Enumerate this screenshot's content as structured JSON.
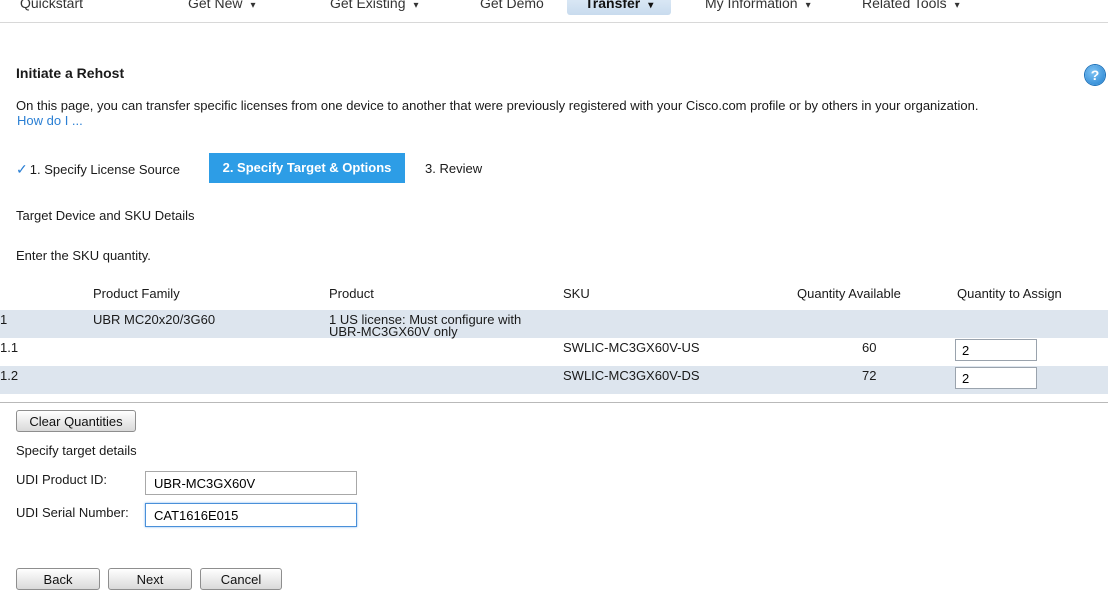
{
  "nav": {
    "items": [
      {
        "label": "Quickstart",
        "caret": ""
      },
      {
        "label": "Get New",
        "caret": "▾"
      },
      {
        "label": "Get Existing",
        "caret": "▾"
      },
      {
        "label": "Get Demo",
        "caret": ""
      },
      {
        "label": "Transfer",
        "caret": "▾"
      },
      {
        "label": "My Information",
        "caret": "▾"
      },
      {
        "label": "Related Tools",
        "caret": "▾"
      }
    ],
    "active_index": 4
  },
  "page": {
    "title": "Initiate a Rehost",
    "help_icon": "?",
    "intro": "On this page, you can transfer specific licenses from one device to another that were previously registered with your Cisco.com profile or by others in your organization.",
    "how_do_i": "How do I ..."
  },
  "steps": {
    "check": "✓",
    "step1": "1. Specify License Source",
    "step2": "2. Specify Target & Options",
    "step3": "3. Review",
    "active_color": "#2d9de6"
  },
  "details": {
    "heading": "Target Device and SKU Details",
    "instruction": "Enter the SKU quantity."
  },
  "table": {
    "headers": {
      "product_family": "Product Family",
      "product": "Product",
      "sku": "SKU",
      "qty_available": "Quantity Available",
      "qty_assign": "Quantity to Assign"
    },
    "rows": [
      {
        "id": "1",
        "product_family": "UBR MC20x20/3G60",
        "product_line1": "1 US license: Must configure with",
        "product_line2": "UBR-MC3GX60V only",
        "sku": "",
        "qty_available": "",
        "qty_assign": ""
      },
      {
        "id": "1.1",
        "product_family": "",
        "product_line1": "",
        "product_line2": "",
        "sku": "SWLIC-MC3GX60V-US",
        "qty_available": "60",
        "qty_assign": "2"
      },
      {
        "id": "1.2",
        "product_family": "",
        "product_line1": "",
        "product_line2": "",
        "sku": "SWLIC-MC3GX60V-DS",
        "qty_available": "72",
        "qty_assign": "2"
      }
    ]
  },
  "buttons": {
    "clear_quantities": "Clear Quantities",
    "back": "Back",
    "next": "Next",
    "cancel": "Cancel"
  },
  "target": {
    "heading": "Specify target details",
    "udi_product_id_label": "UDI Product ID:",
    "udi_product_id_value": "UBR-MC3GX60V",
    "udi_serial_label": "UDI Serial Number:",
    "udi_serial_value": "CAT1616E015"
  }
}
